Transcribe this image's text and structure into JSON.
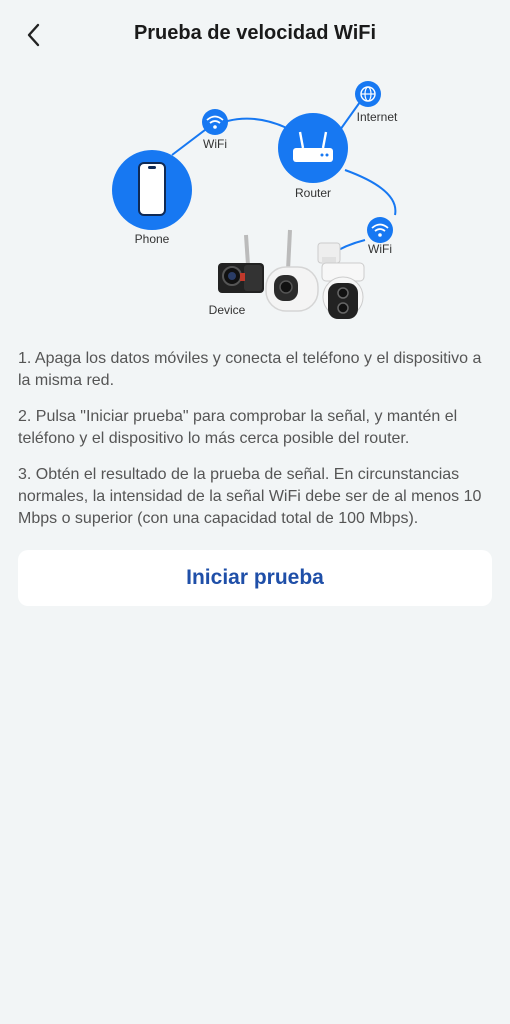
{
  "header": {
    "title": "Prueba de velocidad WiFi"
  },
  "diagram": {
    "phone_label": "Phone",
    "wifi_label_1": "WiFi",
    "router_label": "Router",
    "internet_label": "Internet",
    "wifi_label_2": "WiFi",
    "device_label": "Device",
    "accent_color": "#1778f2"
  },
  "instructions": [
    "1. Apaga los datos móviles y conecta el teléfono y el dispositivo a la misma red.",
    "2. Pulsa \"Iniciar prueba\" para comprobar la señal, y mantén el teléfono y el dispositivo lo más cerca posible del router.",
    "3. Obtén el resultado de la prueba de señal. En circunstancias normales, la intensidad de la señal WiFi debe ser de al menos 10 Mbps o superior (con una capacidad total de 100 Mbps)."
  ],
  "actions": {
    "start_label": "Iniciar prueba"
  },
  "colors": {
    "background": "#f2f5f6",
    "button_text": "#1f4fa8"
  }
}
